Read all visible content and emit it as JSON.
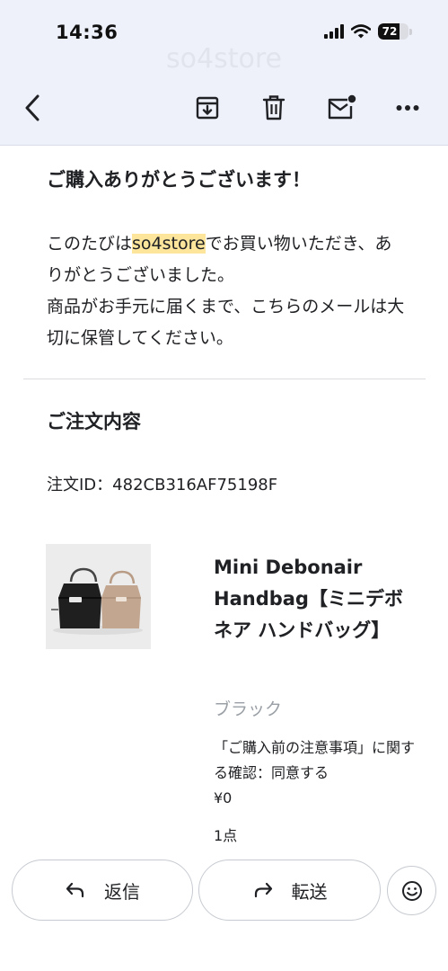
{
  "status_bar": {
    "time": "14:36",
    "battery_percent": "72",
    "battery_level": 0.72
  },
  "header": {
    "ghost_title": "so4store"
  },
  "icons": {
    "back": "chevron-left-icon",
    "archive": "archive-icon",
    "delete": "trash-icon",
    "mark_unread": "mail-unread-icon",
    "more": "more-horizontal-icon",
    "reply": "reply-arrow-icon",
    "forward": "forward-arrow-icon",
    "emoji": "smiley-icon"
  },
  "email": {
    "thanks_heading": "ご購入ありがとうございます！",
    "message_before": "このたびは",
    "store_name": "so4store",
    "message_after": "でお買い物いただき、ありがとうございました。",
    "message_line2": "商品がお手元に届くまで、こちらのメールは大切に保管してください。",
    "order_heading": "ご注文内容",
    "order_id": "注文ID：482CB316AF75198F",
    "product": {
      "name": "Mini Debonair Handbag【ミニデボネア ハンドバッグ】",
      "variant": "ブラック",
      "note": "「ご購入前の注意事項」に関する確認：同意する",
      "price": "¥0",
      "quantity": "1点"
    }
  },
  "actions": {
    "reply_label": "返信",
    "forward_label": "転送"
  },
  "colors": {
    "header_bg": "#eef1fa",
    "highlight": "#fde59c",
    "variant_text": "#9aa0a6"
  }
}
